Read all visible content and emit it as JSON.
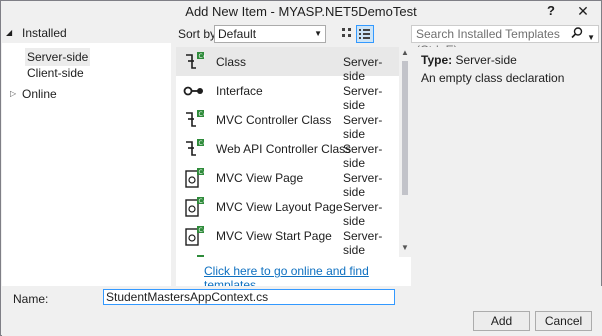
{
  "window": {
    "title": "Add New Item - MYASP.NET5DemoTest",
    "help_label": "?",
    "close_label": "✕"
  },
  "tree": {
    "installed_label": "Installed",
    "children": [
      {
        "label": "Server-side",
        "selected": true
      },
      {
        "label": "Client-side",
        "selected": false
      }
    ],
    "online_label": "Online"
  },
  "sort": {
    "label": "Sort by:",
    "value": "Default"
  },
  "items": [
    {
      "name": "Class",
      "category": "Server-side",
      "icon": "class-icon"
    },
    {
      "name": "Interface",
      "category": "Server-side",
      "icon": "interface-icon"
    },
    {
      "name": "MVC Controller Class",
      "category": "Server-side",
      "icon": "controller-icon"
    },
    {
      "name": "Web API Controller Class",
      "category": "Server-side",
      "icon": "controller-icon"
    },
    {
      "name": "MVC View Page",
      "category": "Server-side",
      "icon": "view-page-icon"
    },
    {
      "name": "MVC View Layout Page",
      "category": "Server-side",
      "icon": "view-page-icon"
    },
    {
      "name": "MVC View Start Page",
      "category": "Server-side",
      "icon": "view-page-icon"
    }
  ],
  "online_link": "Click here to go online and find templates.",
  "search": {
    "placeholder": "Search Installed Templates (Ctrl+E)"
  },
  "details": {
    "type_label": "Type:",
    "type_value": "Server-side",
    "description": "An empty class declaration"
  },
  "bottom": {
    "name_label": "Name:",
    "name_value": "StudentMastersAppContext.cs",
    "add_label": "Add",
    "cancel_label": "Cancel"
  },
  "colors": {
    "accent": "#3399ff",
    "link": "#0e70c0",
    "icon_green": "#2e8b3a"
  }
}
